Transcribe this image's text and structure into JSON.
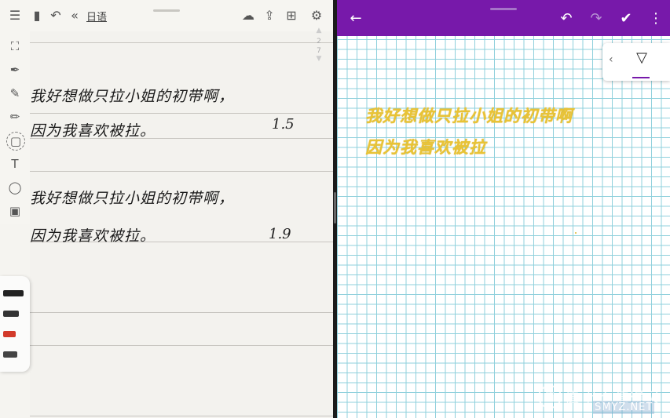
{
  "left_app": {
    "toolbar": {
      "title": "日语",
      "icons": [
        "outline-icon",
        "notebook-icon",
        "undo-icon",
        "collapse-icon",
        "cloud-sync-icon",
        "share-icon",
        "add-page-icon",
        "settings-icon"
      ]
    },
    "page_indicator": {
      "current": "2",
      "total": "7"
    },
    "notes": [
      {
        "line": "我好想做只拉小姐的初带啊，",
        "number": ""
      },
      {
        "line": "因为我喜欢被拉。",
        "number": "1.5"
      },
      {
        "line": "我好想做只拉小姐的初带啊，",
        "number": ""
      },
      {
        "line": "因为我喜欢被拉。",
        "number": "1.9"
      }
    ],
    "tools": [
      "lasso-select-icon",
      "pen-icon",
      "marker-icon",
      "pencil-icon",
      "eraser-icon",
      "text-icon",
      "shapes-icon",
      "sticker-icon"
    ],
    "pens": [
      {
        "name": "pen-black-1",
        "color": "#222222"
      },
      {
        "name": "pen-black-2",
        "color": "#333333"
      },
      {
        "name": "pen-red",
        "color": "#d23a2a"
      },
      {
        "name": "pen-black-3",
        "color": "#444444"
      }
    ]
  },
  "right_app": {
    "appbar": {
      "accent": "#7719aa",
      "icons": [
        "back-icon",
        "undo-icon",
        "redo-icon",
        "ink-to-text-icon",
        "more-icon"
      ]
    },
    "flyout_icons": [
      "chevron-left-icon",
      "highlighter-pen-icon"
    ],
    "notes": [
      "我好想做只拉小姐的初带啊",
      "因为我喜欢被拉"
    ],
    "ink_color": "#e8c336"
  },
  "watermark": {
    "text": "值 什么值得买",
    "url": "SMYZ.NET"
  }
}
